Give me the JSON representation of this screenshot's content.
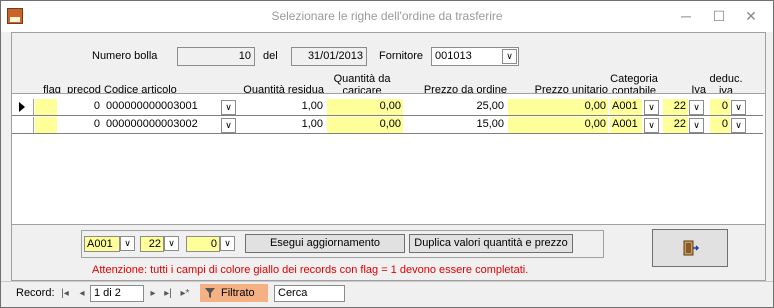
{
  "window": {
    "title": "Selezionare le righe dell'ordine da trasferire",
    "minimize_glyph": "─",
    "maximize_glyph": "☐",
    "close_glyph": "✕"
  },
  "header_fields": {
    "numero_bolla_label": "Numero bolla",
    "numero_bolla_value": "10",
    "del_label": "del",
    "del_value": "31/01/2013",
    "fornitore_label": "Fornitore",
    "fornitore_value": "001013"
  },
  "columns": {
    "flag": "flag",
    "precod": "precod",
    "codice": "Codice articolo",
    "qta_residua": "Quantità residua",
    "qta_caricare": "Quantità da caricare",
    "prezzo_ordine": "Prezzo da ordine",
    "prezzo_unitario": "Prezzo unitario",
    "categoria": "Categoria contabile",
    "iva": "Iva",
    "deduc_iva": "deduc. iva"
  },
  "rows": [
    {
      "flag": "",
      "precod": "0",
      "codice": "000000000003001",
      "qta_residua": "1,00",
      "qta_caricare": "0,00",
      "prezzo_ordine": "25,00",
      "prezzo_unitario": "0,00",
      "categoria": "A001",
      "iva": "22",
      "deduc_iva": "0",
      "selected": true
    },
    {
      "flag": "",
      "precod": "0",
      "codice": "000000000003002",
      "qta_residua": "1,00",
      "qta_caricare": "0,00",
      "prezzo_ordine": "15,00",
      "prezzo_unitario": "0,00",
      "categoria": "A001",
      "iva": "22",
      "deduc_iva": "0",
      "selected": false
    }
  ],
  "footer": {
    "categoria_value": "A001",
    "iva_value": "22",
    "deduc_value": "0",
    "esegui_label": "Esegui aggiornamento",
    "duplica_label": "Duplica valori quantità e prezzo",
    "exit_icon": "exit-door-icon",
    "warning": "Attenzione: tutti i campi di colore giallo dei records con flag = 1 devono essere completati."
  },
  "statusbar": {
    "record_label": "Record:",
    "record_value": "1 di 2",
    "filter_label": "Filtrato",
    "search_value": "Cerca"
  },
  "colors": {
    "yellow_field": "#ffff99",
    "warning_text": "#e00000",
    "filter_bg": "#f4b183"
  }
}
